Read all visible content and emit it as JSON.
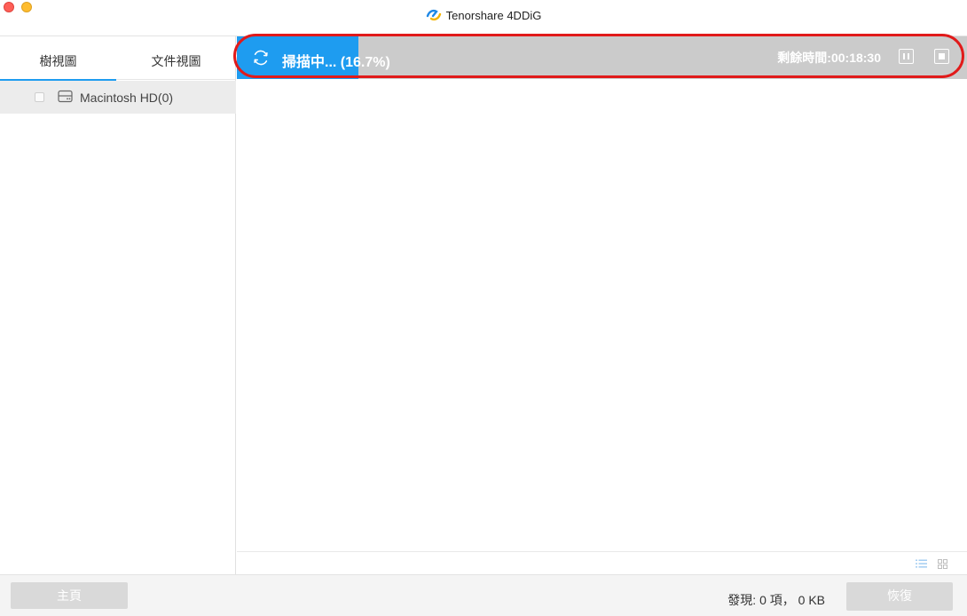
{
  "window": {
    "title": "Tenorshare 4DDiG"
  },
  "sidebar": {
    "tabs": [
      {
        "label": "樹視圖",
        "active": true
      },
      {
        "label": "文件視圖",
        "active": false
      }
    ],
    "tree": [
      {
        "label": "Macintosh HD(0)",
        "checked": false,
        "icon": "disk-icon"
      }
    ]
  },
  "scan": {
    "status": "掃描中... (16.7%)",
    "progress_percent": 16.7,
    "remaining": "剩餘時間:00:18:30"
  },
  "footer": {
    "home_label": "主頁",
    "found_text": "發現: 0 項， 0 KB",
    "recover_label": "恢復"
  },
  "colors": {
    "accent": "#1e9cf0",
    "progress_track": "#cbcbcb",
    "highlight": "#e11a1a",
    "disabled_button": "#d9d9d9"
  }
}
